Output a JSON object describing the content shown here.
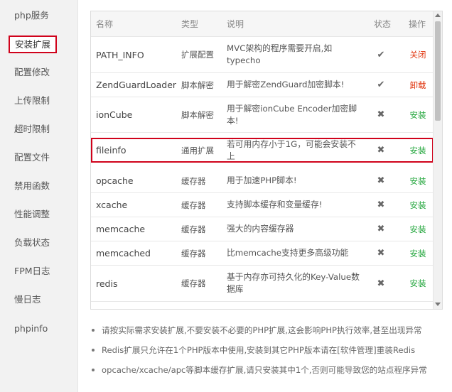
{
  "sidebar": {
    "items": [
      {
        "label": "php服务"
      },
      {
        "label": "安装扩展",
        "active": true
      },
      {
        "label": "配置修改"
      },
      {
        "label": "上传限制"
      },
      {
        "label": "超时限制"
      },
      {
        "label": "配置文件"
      },
      {
        "label": "禁用函数"
      },
      {
        "label": "性能调整"
      },
      {
        "label": "负载状态"
      },
      {
        "label": "FPM日志"
      },
      {
        "label": "慢日志"
      },
      {
        "label": "phpinfo"
      }
    ]
  },
  "table": {
    "headers": {
      "name": "名称",
      "type": "类型",
      "desc": "说明",
      "status": "状态",
      "op": "操作"
    },
    "rows": [
      {
        "name": "PATH_INFO",
        "type": "扩展配置",
        "desc": "MVC架构的程序需要开启,如typecho",
        "status": "check",
        "status_glyph": "✔",
        "op": "关闭",
        "op_color": "red"
      },
      {
        "name": "ZendGuardLoader",
        "type": "脚本解密",
        "desc": "用于解密ZendGuard加密脚本!",
        "status": "check",
        "status_glyph": "✔",
        "op": "卸载",
        "op_color": "red"
      },
      {
        "name": "ionCube",
        "type": "脚本解密",
        "desc": "用于解密ionCube Encoder加密脚本!",
        "status": "cross",
        "status_glyph": "✖",
        "op": "安装",
        "op_color": "green"
      },
      {
        "name": "fileinfo",
        "type": "通用扩展",
        "desc": "若可用内存小于1G，可能会安装不上",
        "status": "cross",
        "status_glyph": "✖",
        "op": "安装",
        "op_color": "green",
        "highlighted": true
      },
      {
        "name": "opcache",
        "type": "缓存器",
        "desc": "用于加速PHP脚本!",
        "status": "cross",
        "status_glyph": "✖",
        "op": "安装",
        "op_color": "green"
      },
      {
        "name": "xcache",
        "type": "缓存器",
        "desc": "支持脚本缓存和变量缓存!",
        "status": "cross",
        "status_glyph": "✖",
        "op": "安装",
        "op_color": "green"
      },
      {
        "name": "memcache",
        "type": "缓存器",
        "desc": "强大的内容缓存器",
        "status": "cross",
        "status_glyph": "✖",
        "op": "安装",
        "op_color": "green"
      },
      {
        "name": "memcached",
        "type": "缓存器",
        "desc": "比memcache支持更多高级功能",
        "status": "cross",
        "status_glyph": "✖",
        "op": "安装",
        "op_color": "green"
      },
      {
        "name": "redis",
        "type": "缓存器",
        "desc": "基于内存亦可持久化的Key-Value数据库",
        "status": "cross",
        "status_glyph": "✖",
        "op": "安装",
        "op_color": "green"
      }
    ]
  },
  "tips": [
    "请按实际需求安装扩展,不要安装不必要的PHP扩展,这会影响PHP执行效率,甚至出现异常",
    "Redis扩展只允许在1个PHP版本中使用,安装到其它PHP版本请在[软件管理]重装Redis",
    "opcache/xcache/apc等脚本缓存扩展,请只安装其中1个,否则可能导致您的站点程序异常"
  ],
  "colors": {
    "highlight_border": "#d0021b",
    "op_red": "#e0320a",
    "op_green": "#20a53a"
  }
}
